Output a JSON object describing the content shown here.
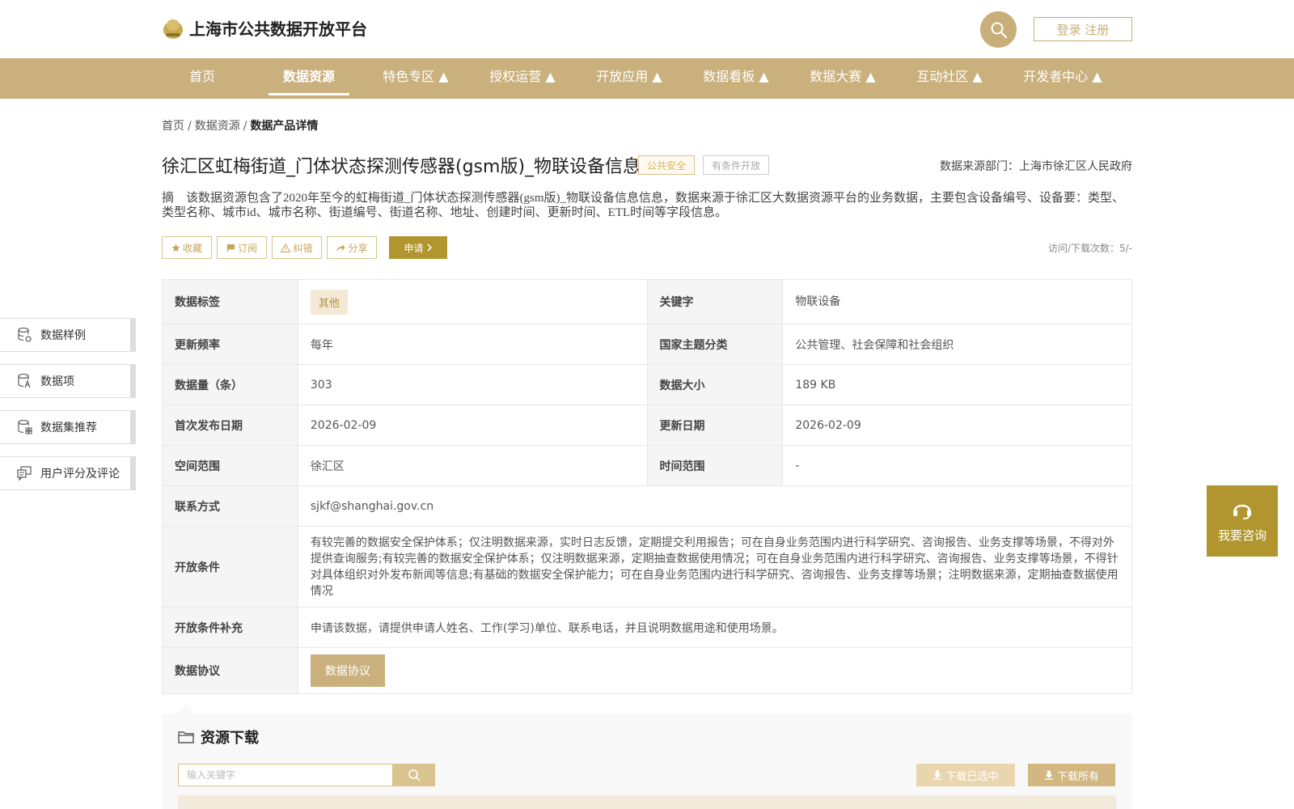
{
  "header": {
    "site_title": "上海市公共数据开放平台",
    "login_label": "登录 注册"
  },
  "nav": {
    "items": [
      {
        "label": "首页"
      },
      {
        "label": "数据资源"
      },
      {
        "label": "特色专区 ▲"
      },
      {
        "label": "授权运营 ▲"
      },
      {
        "label": "开放应用 ▲"
      },
      {
        "label": "数据看板 ▲"
      },
      {
        "label": "数据大赛 ▲"
      },
      {
        "label": "互动社区 ▲"
      },
      {
        "label": "开发者中心 ▲"
      }
    ],
    "active_index": 1
  },
  "breadcrumb": {
    "home": "首页",
    "parent": "数据资源",
    "current": "数据产品详情",
    "sep": "/"
  },
  "dataset": {
    "title": "徐汇区虹梅街道_门体状态探测传感器(gsm版)_物联设备信息",
    "tag_category": "公共安全",
    "tag_access": "有条件开放",
    "source_dept": "数据来源部门：上海市徐汇区人民政府",
    "abstract": "摘　该数据资源包含了2020年至今的虹梅街道_门体状态探测传感器(gsm版)_物联设备信息信息，数据来源于徐汇区大数据资源平台的业务数据，主要包含设备编号、设备要：类型、类型名称、城市id、城市名称、街道编号、街道名称、地址、创建时间、更新时间、ETL时间等字段信息。"
  },
  "actions": {
    "favorite": "收藏",
    "subscribe": "订阅",
    "report": "纠错",
    "share": "分享",
    "apply": "申请",
    "visits": "访问/下载次数：5/-"
  },
  "side": {
    "items": [
      {
        "label": "数据样例"
      },
      {
        "label": "数据项"
      },
      {
        "label": "数据集推荐"
      },
      {
        "label": "用户评分及评论"
      }
    ]
  },
  "info": {
    "tag_label": "数据标签",
    "tag_value": "其他",
    "keyword_label": "关键字",
    "keyword_value": "物联设备",
    "freq_label": "更新频率",
    "freq_value": "每年",
    "theme_label": "国家主题分类",
    "theme_value": "公共管理、社会保障和社会组织",
    "count_label": "数据量（条）",
    "count_value": "303",
    "size_label": "数据大小",
    "size_value": "189 KB",
    "first_label": "首次发布日期",
    "first_value": "2026-02-09",
    "update_label": "更新日期",
    "update_value": "2026-02-09",
    "space_label": "空间范围",
    "space_value": "徐汇区",
    "time_label": "时间范围",
    "time_value": "-",
    "contact_label": "联系方式",
    "contact_value": "sjkf@shanghai.gov.cn",
    "cond_label": "开放条件",
    "cond_value": "有较完善的数据安全保护体系；仅注明数据来源，实时日志反馈，定期提交利用报告；可在自身业务范围内进行科学研究、咨询报告、业务支撑等场景，不得对外提供查询服务;有较完善的数据安全保护体系；仅注明数据来源，定期抽查数据使用情况；可在自身业务范围内进行科学研究、咨询报告、业务支撑等场景，不得针对具体组织对外发布新闻等信息;有基础的数据安全保护能力；可在自身业务范围内进行科学研究、咨询报告、业务支撑等场景；注明数据来源，定期抽查数据使用情况",
    "supp_label": "开放条件补充",
    "supp_value": "申请该数据，请提供申请人姓名、工作(学习)单位、联系电话，并且说明数据用途和使用场景。",
    "proto_label": "数据协议",
    "proto_button": "数据协议"
  },
  "download": {
    "title": "资源下载",
    "search_placeholder": "输入关键字",
    "download_selected": "下载已选中",
    "download_all": "下载所有"
  },
  "consult": {
    "label": "我要咨询"
  },
  "colors": {
    "brand": "#c9b07d",
    "accent_dark": "#b1962f"
  }
}
